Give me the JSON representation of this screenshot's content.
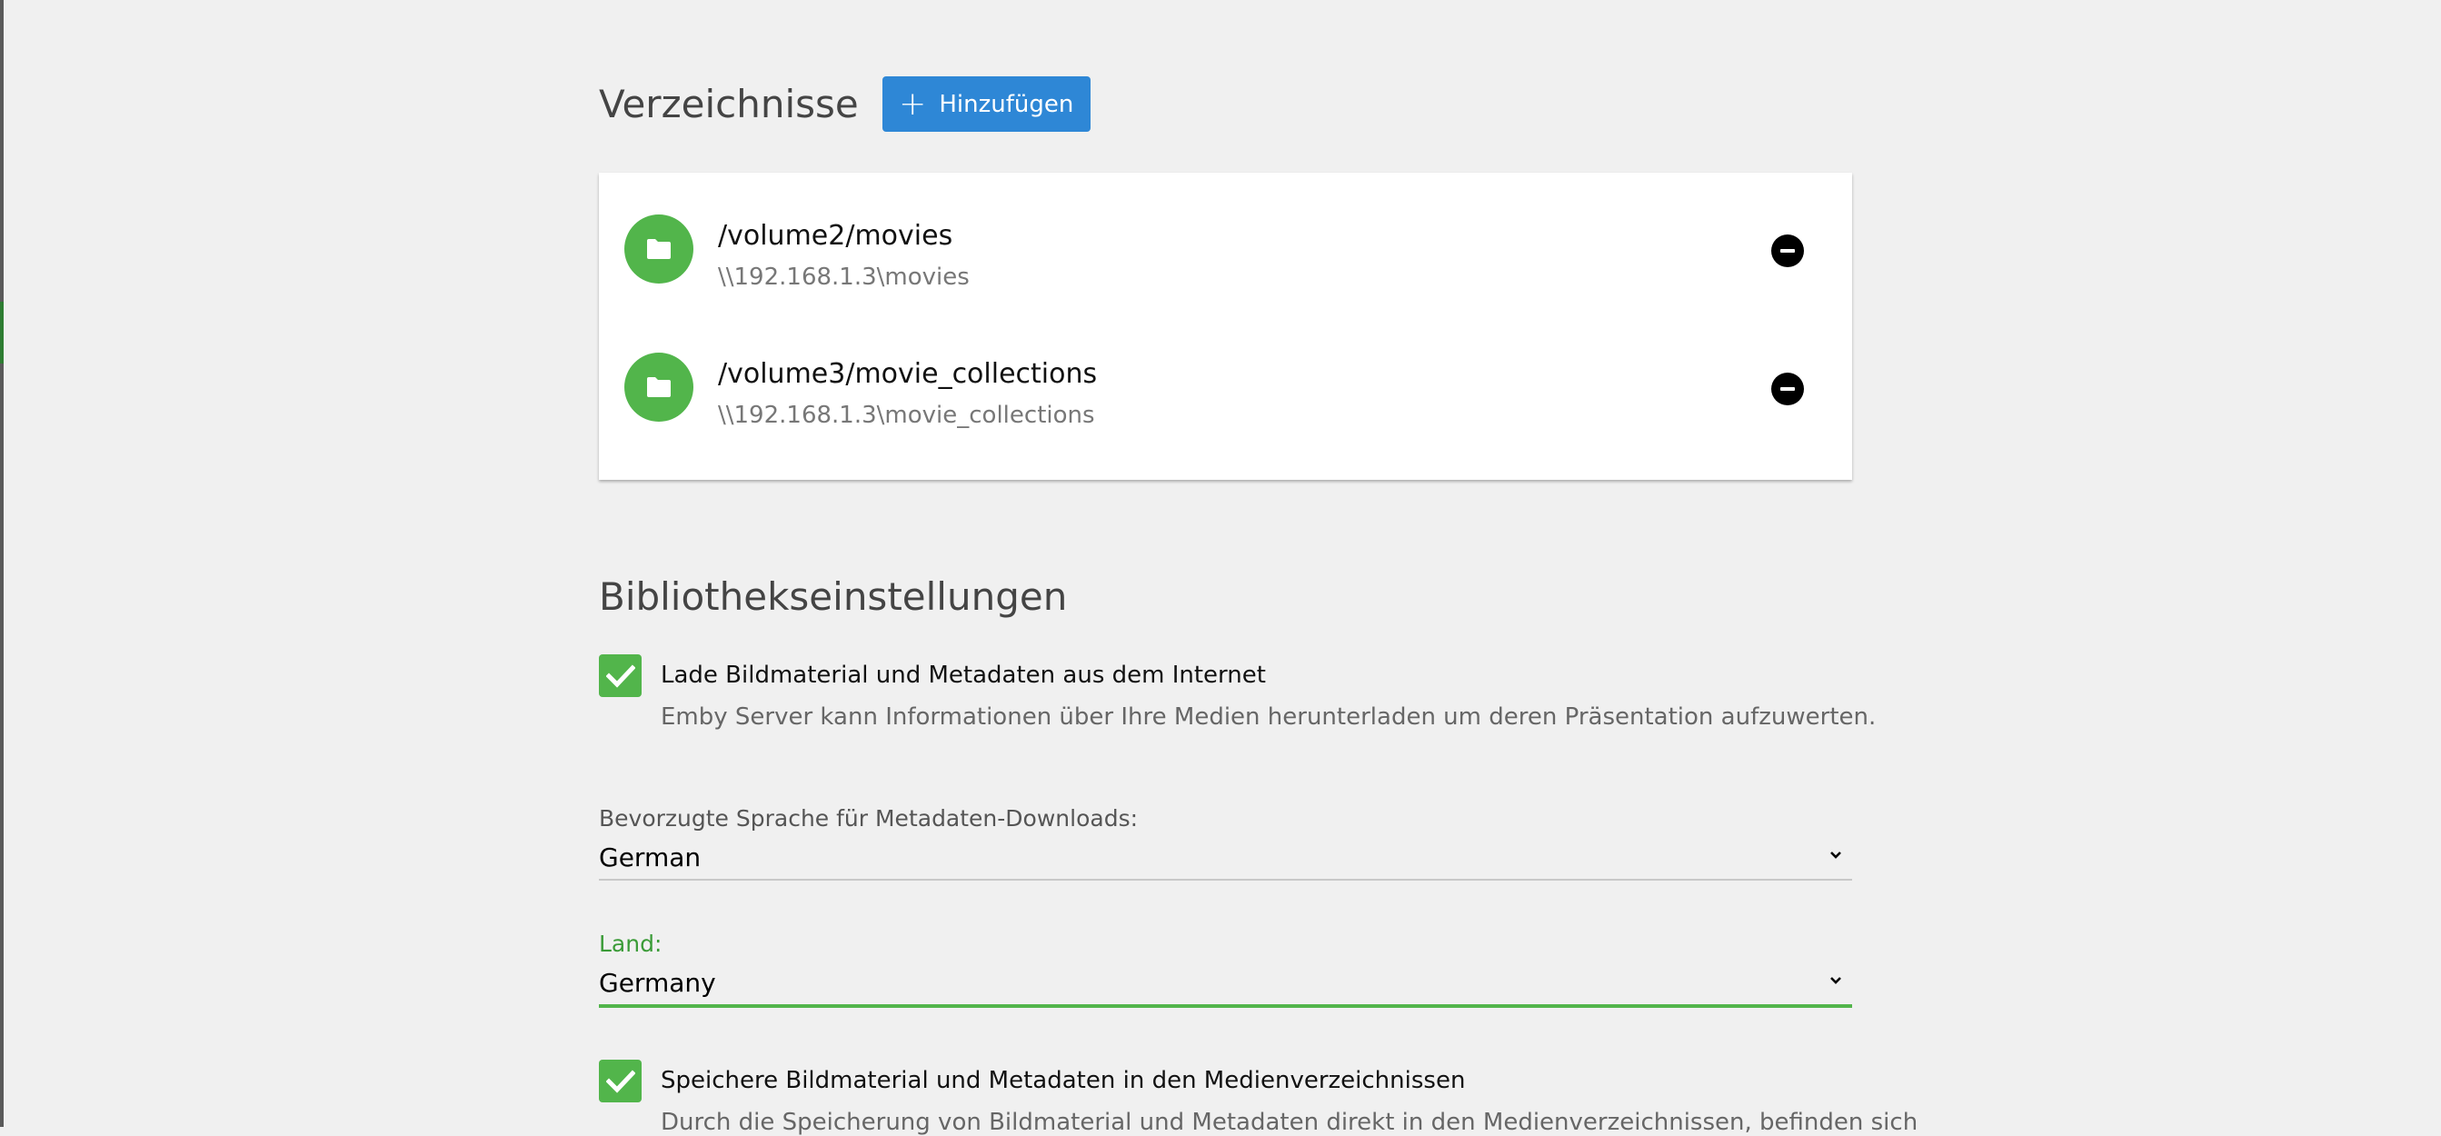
{
  "folders": {
    "title": "Verzeichnisse",
    "add_label": "Hinzufügen",
    "items": [
      {
        "path": "/volume2/movies",
        "share": "\\\\192.168.1.3\\movies"
      },
      {
        "path": "/volume3/movie_collections",
        "share": "\\\\192.168.1.3\\movie_collections"
      }
    ]
  },
  "settings": {
    "title": "Bibliothekseinstellungen",
    "download_metadata": {
      "label": "Lade Bildmaterial und Metadaten aus dem Internet",
      "description": "Emby Server kann Informationen über Ihre Medien herunterladen um deren Präsentation aufzuwerten.",
      "checked": true
    },
    "language": {
      "label": "Bevorzugte Sprache für Metadaten-Downloads:",
      "value": "German"
    },
    "country": {
      "label": "Land:",
      "value": "Germany"
    },
    "save_local": {
      "label": "Speichere Bildmaterial und Metadaten in den Medienverzeichnissen",
      "description": "Durch die Speicherung von Bildmaterial und Metadaten direkt in den Medienverzeichnissen, befinden sich",
      "checked": true
    }
  },
  "colors": {
    "accent_green": "#52b54b",
    "button_blue": "#2e87d6",
    "background": "#f0f0f0"
  },
  "icons": {
    "add": "plus-icon",
    "folder": "folder-icon",
    "remove": "minus-circle-icon",
    "check": "checkmark-icon",
    "dropdown": "chevron-down-icon"
  }
}
